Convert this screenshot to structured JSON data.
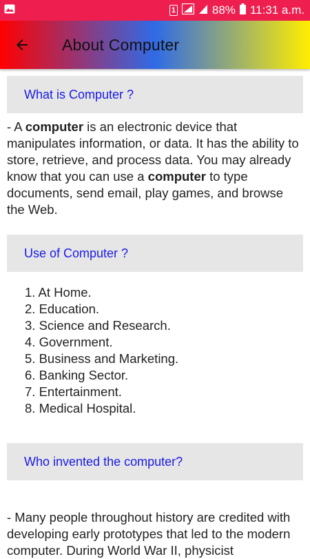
{
  "status_bar": {
    "sim_badge": "1",
    "battery": "88%",
    "time": "11:31 a.m."
  },
  "appbar": {
    "title": "About Computer"
  },
  "sections": [
    {
      "heading": "What is Computer ?",
      "paragraph": {
        "prefix": "- A ",
        "bold1": "computer",
        "middle": " is an electronic device that manipulates information, or data. It has the ability to store, retrieve, and process data. You may already know that you can use a ",
        "bold2": "computer",
        "suffix": " to type documents, send email, play games, and browse the Web."
      }
    },
    {
      "heading": "Use of Computer ?",
      "items": [
        "1. At Home.",
        "2. Education.",
        "3. Science and Research.",
        "4. Government.",
        "5. Business and Marketing.",
        "6. Banking Sector.",
        "7. Entertainment.",
        "8. Medical Hospital."
      ]
    },
    {
      "heading": "Who invented the computer?",
      "paragraph_text": "- Many people throughout history are credited with developing early prototypes that led to the modern computer. During World War II, physicist"
    }
  ],
  "colors": {
    "status_bar": "#ee1f4f",
    "heading_text": "#1a1ae6",
    "section_bg": "#e6e6e6"
  }
}
